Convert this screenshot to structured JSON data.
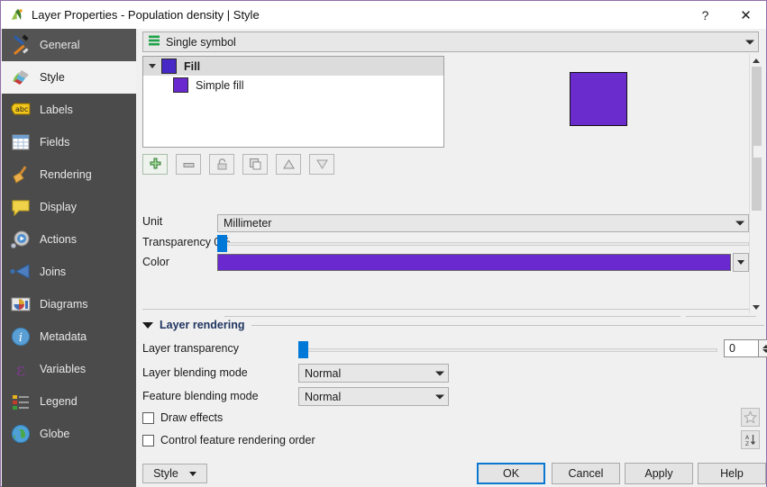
{
  "window": {
    "title": "Layer Properties - Population density | Style",
    "app_icon": "qgis-icon",
    "help_button": "?",
    "close_button": "✕"
  },
  "sidebar": {
    "items": [
      {
        "label": "General",
        "icon": "tools-icon",
        "state": "hover"
      },
      {
        "label": "Style",
        "icon": "brush-icon",
        "state": "selected"
      },
      {
        "label": "Labels",
        "icon": "abc-label-icon",
        "state": "normal"
      },
      {
        "label": "Fields",
        "icon": "table-icon",
        "state": "normal"
      },
      {
        "label": "Rendering",
        "icon": "broom-icon",
        "state": "normal"
      },
      {
        "label": "Display",
        "icon": "speech-bubble-icon",
        "state": "normal"
      },
      {
        "label": "Actions",
        "icon": "gear-play-icon",
        "state": "normal"
      },
      {
        "label": "Joins",
        "icon": "join-arrow-icon",
        "state": "normal"
      },
      {
        "label": "Diagrams",
        "icon": "chart-icon",
        "state": "normal"
      },
      {
        "label": "Metadata",
        "icon": "info-icon",
        "state": "normal"
      },
      {
        "label": "Variables",
        "icon": "epsilon-icon",
        "state": "normal"
      },
      {
        "label": "Legend",
        "icon": "legend-icon",
        "state": "normal"
      },
      {
        "label": "Globe",
        "icon": "globe-icon",
        "state": "normal"
      }
    ]
  },
  "style_panel": {
    "renderer_combo": {
      "value": "Single symbol",
      "icon": "single-symbol-icon"
    },
    "symbol_tree": {
      "nodes": [
        {
          "label": "Fill",
          "color": "#4729c6",
          "bold": true,
          "selected": true,
          "expanded": true
        },
        {
          "label": "Simple fill",
          "color": "#6a28cf",
          "bold": false,
          "selected": false,
          "child": true
        }
      ]
    },
    "symbol_toolbar": [
      {
        "name": "add-symbol-layer-button",
        "icon": "plus-icon"
      },
      {
        "name": "remove-symbol-layer-button",
        "icon": "minus-icon"
      },
      {
        "name": "lock-layer-button",
        "icon": "lock-icon"
      },
      {
        "name": "duplicate-layer-button",
        "icon": "copy-icon"
      },
      {
        "name": "move-up-button",
        "icon": "triangle-up-icon"
      },
      {
        "name": "move-down-button",
        "icon": "triangle-down-icon"
      }
    ],
    "preview_color": "#6a2ccd",
    "properties": {
      "unit_label": "Unit",
      "unit_value": "Millimeter",
      "transparency_label": "Transparency 0%",
      "transparency_value": 0,
      "color_label": "Color",
      "color_value": "#6a28cf"
    }
  },
  "layer_rendering": {
    "section_title": "Layer rendering",
    "transparency_label": "Layer transparency",
    "transparency_value": "0",
    "layer_blending_label": "Layer blending mode",
    "layer_blending_value": "Normal",
    "feature_blending_label": "Feature blending mode",
    "feature_blending_value": "Normal",
    "draw_effects_label": "Draw effects",
    "draw_effects_checked": false,
    "render_order_label": "Control feature rendering order",
    "render_order_checked": false,
    "effects_button_icon": "star-icon",
    "order_button_icon": "sort-az-icon"
  },
  "buttons": {
    "style_menu": "Style",
    "ok": "OK",
    "cancel": "Cancel",
    "apply": "Apply",
    "help": "Help"
  }
}
